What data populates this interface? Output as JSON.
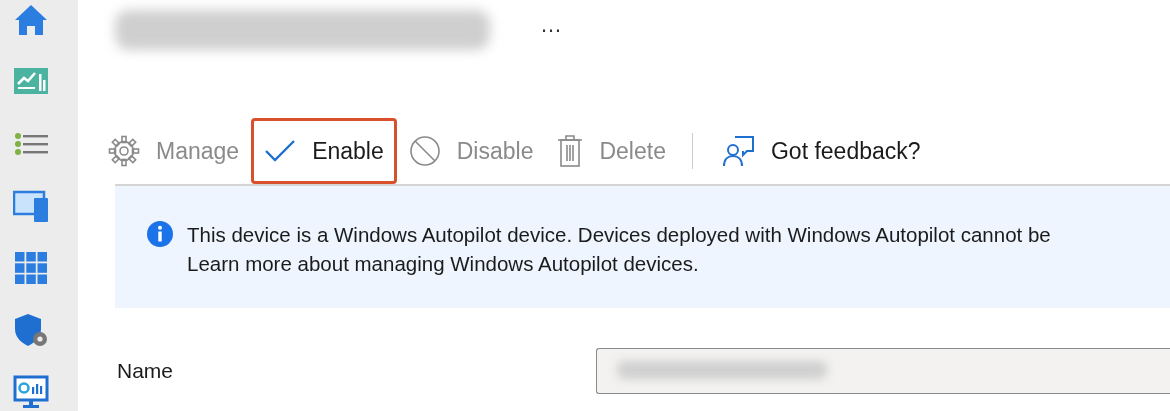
{
  "header": {
    "more_button": "…"
  },
  "toolbar": {
    "buttons": [
      {
        "label": "Manage",
        "kind": "gear",
        "disabled": true,
        "highlighted": false
      },
      {
        "label": "Enable",
        "kind": "check",
        "disabled": false,
        "highlighted": true
      },
      {
        "label": "Disable",
        "kind": "block",
        "disabled": true,
        "highlighted": false
      },
      {
        "label": "Delete",
        "kind": "trash",
        "disabled": true,
        "highlighted": false
      },
      {
        "label": "Got feedback?",
        "kind": "feedback",
        "disabled": false,
        "highlighted": false
      }
    ]
  },
  "notice": {
    "lines": [
      "This device is a Windows Autopilot device. Devices deployed with Windows Autopilot cannot be",
      "Learn more about managing Windows Autopilot devices."
    ]
  },
  "fields": [
    {
      "label": "Name"
    }
  ]
}
